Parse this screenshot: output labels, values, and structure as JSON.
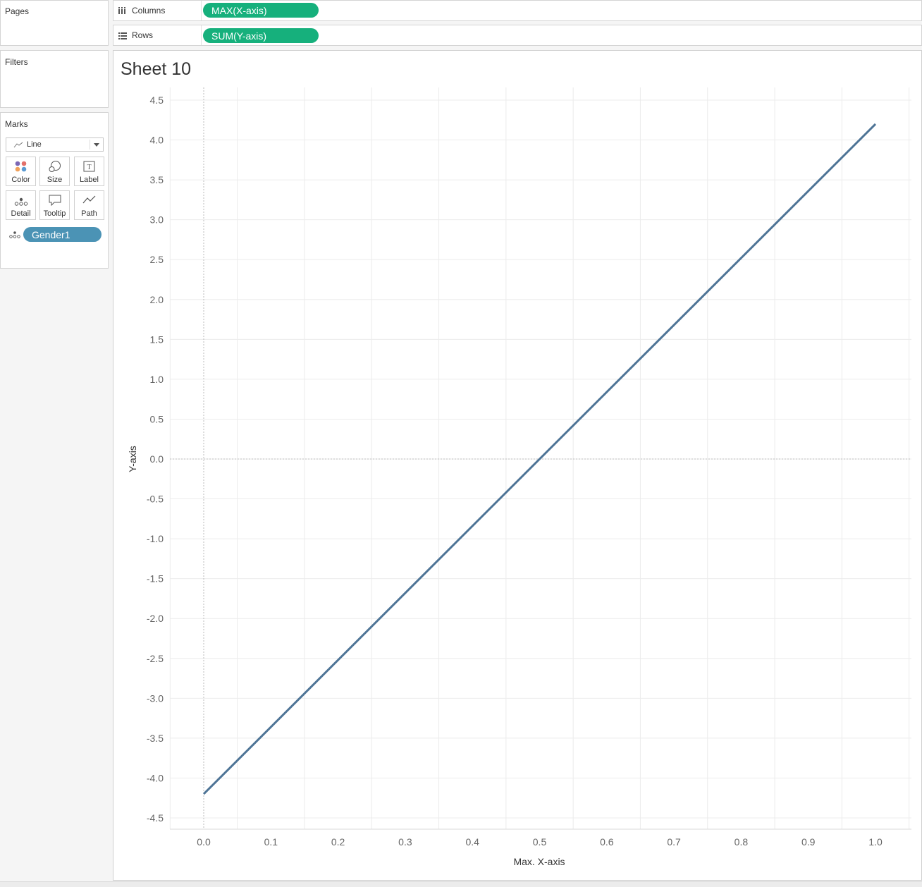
{
  "panels": {
    "pages_label": "Pages",
    "filters_label": "Filters",
    "marks_label": "Marks"
  },
  "shelves": {
    "columns_label": "Columns",
    "columns_pill": "MAX(X-axis)",
    "rows_label": "Rows",
    "rows_pill": "SUM(Y-axis)"
  },
  "marks": {
    "mark_type": "Line",
    "buttons": {
      "color": "Color",
      "size": "Size",
      "label": "Label",
      "detail": "Detail",
      "tooltip": "Tooltip",
      "path": "Path"
    },
    "detail_pill": "Gender1"
  },
  "sheet": {
    "title": "Sheet 10"
  },
  "colors": {
    "pill_green": "#16b07c",
    "pill_blue": "#4b93b5",
    "line": "#4e7496",
    "grid": "#ececec",
    "axis_text": "#666666"
  },
  "chart_data": {
    "type": "line",
    "title": "Sheet 10",
    "xlabel": "Max. X-axis",
    "ylabel": "Y-axis",
    "xlim": [
      -0.05,
      1.05
    ],
    "ylim": [
      -4.65,
      4.65
    ],
    "x_ticks": [
      "0.0",
      "0.1",
      "0.2",
      "0.3",
      "0.4",
      "0.5",
      "0.6",
      "0.7",
      "0.8",
      "0.9",
      "1.0"
    ],
    "y_ticks": [
      "4.5",
      "4.0",
      "3.5",
      "3.0",
      "2.5",
      "2.0",
      "1.5",
      "1.0",
      "0.5",
      "0.0",
      "-0.5",
      "-1.0",
      "-1.5",
      "-2.0",
      "-2.5",
      "-3.0",
      "-3.5",
      "-4.0",
      "-4.5"
    ],
    "grid": true,
    "series": [
      {
        "x": [
          0.0,
          1.0
        ],
        "y": [
          -4.2,
          4.2
        ]
      }
    ]
  }
}
